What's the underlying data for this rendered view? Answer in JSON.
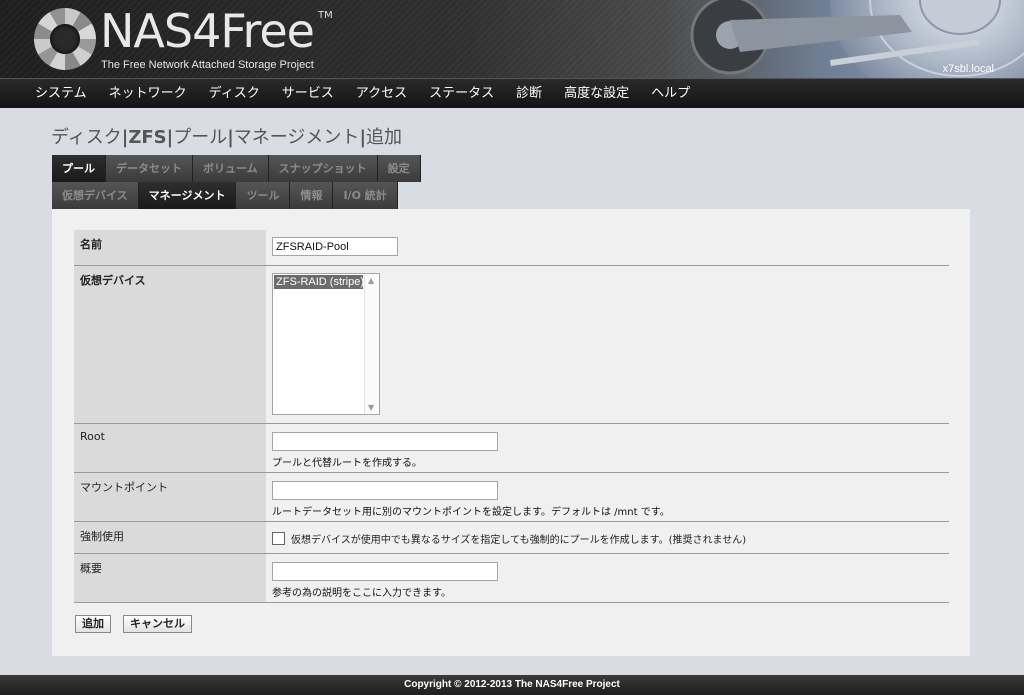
{
  "header": {
    "logo_nas": "NAS",
    "logo_free": "4Free",
    "trademark": "TM",
    "tagline": "The Free Network Attached Storage Project",
    "hostname": "x7sbl.local"
  },
  "mainnav": [
    "システム",
    "ネットワーク",
    "ディスク",
    "サービス",
    "アクセス",
    "ステータス",
    "診断",
    "高度な設定",
    "ヘルプ"
  ],
  "breadcrumb": {
    "part1": "ディスク",
    "sep1": "|",
    "part2": "ZFS",
    "sep2": "|",
    "part3": "プール",
    "sep3": "|",
    "part4": "マネージメント",
    "sep4": "|",
    "part5": "追加"
  },
  "tabs_row1": [
    "プール",
    "データセット",
    "ボリューム",
    "スナップショット",
    "設定"
  ],
  "tabs_row2": [
    "仮想デバイス",
    "マネージメント",
    "ツール",
    "情報",
    "I/O 統計"
  ],
  "form": {
    "name_label": "名前",
    "name_value": "ZFSRAID-Pool",
    "vdev_label": "仮想デバイス",
    "vdev_option": "ZFS-RAID (stripe)",
    "root_label": "Root",
    "root_value": "",
    "root_hint": "プールと代替ルートを作成する。",
    "mount_label": "マウントポイント",
    "mount_value": "",
    "mount_hint": "ルートデータセット用に別のマウントポイントを設定します。デフォルトは /mnt です。",
    "force_label": "強制使用",
    "force_text": "仮想デバイスが使用中でも異なるサイズを指定しても強制的にプールを作成します。(推奨されません)",
    "desc_label": "概要",
    "desc_value": "",
    "desc_hint": "参考の為の説明をここに入力できます。"
  },
  "buttons": {
    "add": "追加",
    "cancel": "キャンセル"
  },
  "footer": {
    "copyright": "Copyright © 2012-2013 The NAS4Free Project"
  },
  "colors": {
    "header_dark": "#1e1e1e",
    "nav_bg": "#141414",
    "page_bg": "#d9dde3",
    "panel_bg": "#f0f0f0",
    "label_bg": "#dadada",
    "tab_active": "#1a1a1a",
    "tab_inactive": "#3b3b3b"
  }
}
